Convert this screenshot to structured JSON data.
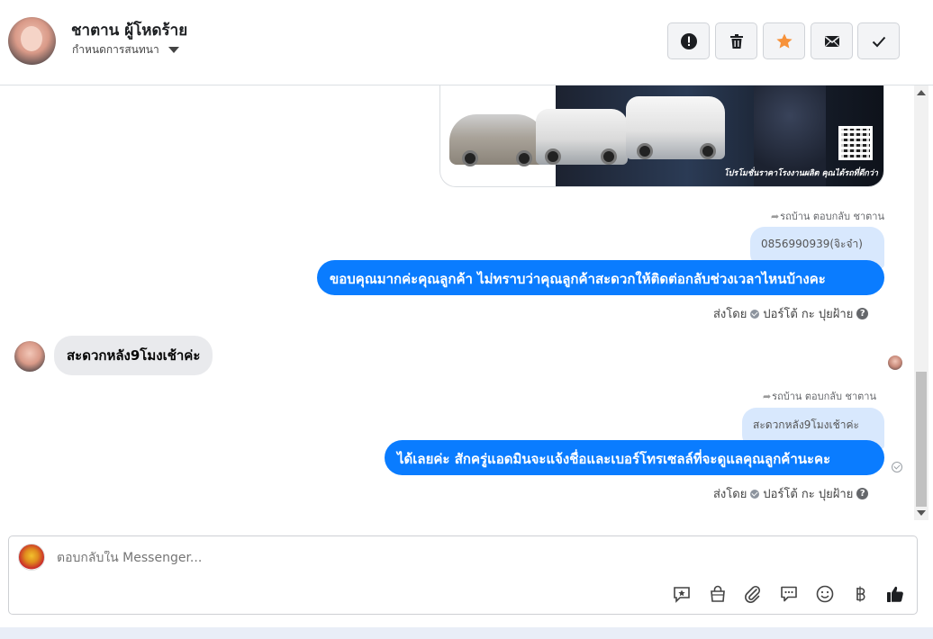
{
  "header": {
    "contact_name": "ชาตาน ผู้โหดร้าย",
    "thread_setting": "กำหนดการสนทนา",
    "actions": [
      {
        "name": "report-button",
        "icon": "alert-icon"
      },
      {
        "name": "delete-button",
        "icon": "trash-icon"
      },
      {
        "name": "star-button",
        "icon": "star-icon"
      },
      {
        "name": "mark-unread-button",
        "icon": "envelope-icon"
      },
      {
        "name": "done-button",
        "icon": "check-icon"
      }
    ]
  },
  "image_card": {
    "promo_text": "โปรโมชั่นราคาโรงงานผลิต คุณได้รถที่ดีกว่า"
  },
  "messages": {
    "reply1_note": "รถบ้าน ตอบกลับ ชาตาน",
    "reply1_quote": "0856990939(จิะจ๋า)",
    "reply1_text": "ขอบคุณมากค่ะคุณลูกค้า ไม่ทราบว่าคุณลูกค้าสะดวกให้ติดต่อกลับช่วงเวลาไหนบ้างคะ",
    "sent_by_label": "ส่งโดย",
    "sender_name": "ปอร์โต้ กะ ปุยฝ้าย",
    "incoming_text": "สะดวกหลัง9โมงเช้าค่ะ",
    "reply2_note": "รถบ้าน ตอบกลับ ชาตาน",
    "reply2_quote": "สะดวกหลัง9โมงเช้าค่ะ",
    "reply2_text": "ได้เลยค่ะ สักครู่แอดมินจะแจ้งชื่อและเบอร์โทรเซลล์ที่จะดูแลคุณลูกค้านะคะ"
  },
  "composer": {
    "placeholder": "ตอบกลับใน Messenger...",
    "tools": [
      "saved-reply-icon",
      "shop-bag-icon",
      "paperclip-icon",
      "chat-bubbles-icon",
      "emoji-icon",
      "baht-icon",
      "thumbs-up-icon"
    ]
  },
  "colors": {
    "outgoing_bubble": "#0a7cff",
    "quoted_bubble": "#d8e8fd",
    "incoming_bubble": "#e9eaed",
    "star_accent": "#f7923a"
  }
}
